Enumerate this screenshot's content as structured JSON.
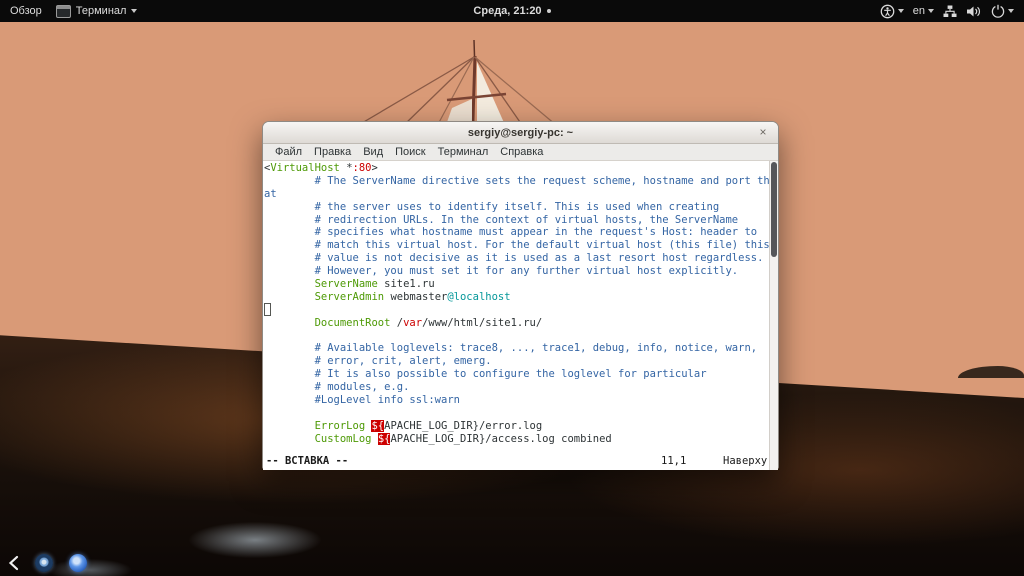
{
  "top_bar": {
    "activities_label": "Обзор",
    "app_name": "Терминал",
    "clock": "Среда, 21:20",
    "keyboard_layout": "en"
  },
  "icons": {
    "app": "terminal-window",
    "accessibility": "person-in-circle",
    "network": "wired-network",
    "volume": "speaker-loud",
    "power": "power-switch",
    "dock_back": "chevron-left",
    "dock_items": [
      "clock-app",
      "blue-sphere-app"
    ]
  },
  "window": {
    "title": "sergiy@sergiy-pc: ~",
    "close_glyph": "×",
    "menus": [
      "Файл",
      "Правка",
      "Вид",
      "Поиск",
      "Терминал",
      "Справка"
    ]
  },
  "terminal": {
    "palette": {
      "default": "#2e3436",
      "comment_blue": "#3465a4",
      "directive_green": "#4e9a06",
      "value_red": "#cc0000",
      "cyan": "#06989a",
      "error_fg": "#ffffff",
      "error_bg": "#cc0000",
      "background": "#ffffff"
    },
    "status": {
      "mode": "-- ВСТАВКА --",
      "ruler": "11,1",
      "scroll_position": "Наверху"
    },
    "lines": [
      [
        [
          "k",
          "<"
        ],
        [
          "g",
          "VirtualHost"
        ],
        [
          "k",
          " *"
        ],
        [
          "r",
          ":80"
        ],
        [
          "k",
          ">"
        ]
      ],
      [
        [
          "k",
          "        "
        ],
        [
          "b",
          "# The ServerName directive sets the request scheme, hostname and port th"
        ]
      ],
      [
        [
          "b",
          "at"
        ]
      ],
      [
        [
          "k",
          "        "
        ],
        [
          "b",
          "# the server uses to identify itself. This is used when creating"
        ]
      ],
      [
        [
          "k",
          "        "
        ],
        [
          "b",
          "# redirection URLs. In the context of virtual hosts, the ServerName"
        ]
      ],
      [
        [
          "k",
          "        "
        ],
        [
          "b",
          "# specifies what hostname must appear in the request's Host: header to"
        ]
      ],
      [
        [
          "k",
          "        "
        ],
        [
          "b",
          "# match this virtual host. For the default virtual host (this file) this"
        ]
      ],
      [
        [
          "k",
          "        "
        ],
        [
          "b",
          "# value is not decisive as it is used as a last resort host regardless."
        ]
      ],
      [
        [
          "k",
          "        "
        ],
        [
          "b",
          "# However, you must set it for any further virtual host explicitly."
        ]
      ],
      [
        [
          "k",
          "        "
        ],
        [
          "g",
          "ServerName"
        ],
        [
          "k",
          " site1.ru"
        ]
      ],
      [
        [
          "k",
          "        "
        ],
        [
          "g",
          "ServerAdmin"
        ],
        [
          "k",
          " webmaster"
        ],
        [
          "c",
          "@localhost"
        ]
      ],
      [],
      [
        [
          "k",
          "        "
        ],
        [
          "g",
          "DocumentRoot"
        ],
        [
          "k",
          " /"
        ],
        [
          "r",
          "var"
        ],
        [
          "k",
          "/www/html/site1.ru/"
        ]
      ],
      [],
      [
        [
          "k",
          "        "
        ],
        [
          "b",
          "# Available loglevels: trace8, ..., trace1, debug, info, notice, warn,"
        ]
      ],
      [
        [
          "k",
          "        "
        ],
        [
          "b",
          "# error, crit, alert, emerg."
        ]
      ],
      [
        [
          "k",
          "        "
        ],
        [
          "b",
          "# It is also possible to configure the loglevel for particular"
        ]
      ],
      [
        [
          "k",
          "        "
        ],
        [
          "b",
          "# modules, e.g."
        ]
      ],
      [
        [
          "k",
          "        "
        ],
        [
          "b",
          "#LogLevel info ssl:warn"
        ]
      ],
      [],
      [
        [
          "k",
          "        "
        ],
        [
          "g",
          "ErrorLog"
        ],
        [
          "k",
          " "
        ],
        [
          "e",
          "${"
        ],
        [
          "k",
          "APACHE_LOG_DIR}/error.log"
        ]
      ],
      [
        [
          "k",
          "        "
        ],
        [
          "g",
          "CustomLog"
        ],
        [
          "k",
          " "
        ],
        [
          "e",
          "${"
        ],
        [
          "k",
          "APACHE_LOG_DIR}/access.log combined"
        ]
      ]
    ]
  }
}
